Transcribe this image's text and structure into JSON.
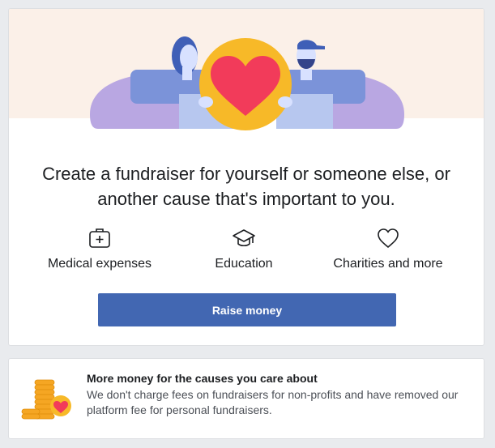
{
  "fundraiser_card": {
    "headline_line1": "Create a fundraiser for yourself or someone else, or",
    "headline_line2": "another cause that's important to you.",
    "causes": [
      {
        "label": "Medical expenses",
        "icon": "medical-kit-icon"
      },
      {
        "label": "Education",
        "icon": "graduation-cap-icon"
      },
      {
        "label": "Charities and more",
        "icon": "heart-outline-icon"
      }
    ],
    "raise_button_label": "Raise money"
  },
  "info_card": {
    "title": "More money for the causes you care about",
    "text": "We don't charge fees on fundraisers for non-profits and have removed our platform fee for personal fundraisers."
  },
  "colors": {
    "page_background": "#e9ebee",
    "button": "#4267b2",
    "hero_background": "#fbf0e8",
    "heart": "#f23b5a",
    "coin_circle": "#f7b928"
  }
}
